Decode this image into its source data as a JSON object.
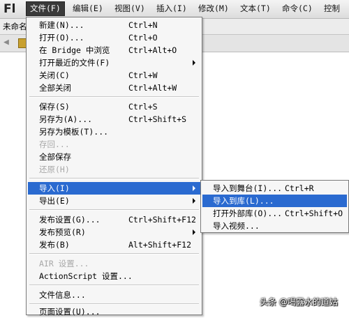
{
  "app": {
    "logo": "Fl"
  },
  "menubar": [
    "文件(F)",
    "编辑(E)",
    "视图(V)",
    "插入(I)",
    "修改(M)",
    "文本(T)",
    "命令(C)",
    "控制"
  ],
  "doc_tab": "未命名",
  "file_menu": {
    "items": [
      {
        "label": "新建(N)...",
        "shortcut": "Ctrl+N"
      },
      {
        "label": "打开(O)...",
        "shortcut": "Ctrl+O"
      },
      {
        "label": "在 Bridge 中浏览",
        "shortcut": "Ctrl+Alt+O"
      },
      {
        "label": "打开最近的文件(F)",
        "shortcut": ""
      },
      {
        "label": "关闭(C)",
        "shortcut": "Ctrl+W"
      },
      {
        "label": "全部关闭",
        "shortcut": "Ctrl+Alt+W"
      },
      {
        "label": "保存(S)",
        "shortcut": "Ctrl+S"
      },
      {
        "label": "另存为(A)...",
        "shortcut": "Ctrl+Shift+S"
      },
      {
        "label": "另存为模板(T)...",
        "shortcut": ""
      },
      {
        "label": "存回...",
        "shortcut": ""
      },
      {
        "label": "全部保存",
        "shortcut": ""
      },
      {
        "label": "还原(H)",
        "shortcut": ""
      },
      {
        "label": "导入(I)",
        "shortcut": ""
      },
      {
        "label": "导出(E)",
        "shortcut": ""
      },
      {
        "label": "发布设置(G)...",
        "shortcut": "Ctrl+Shift+F12"
      },
      {
        "label": "发布预览(R)",
        "shortcut": ""
      },
      {
        "label": "发布(B)",
        "shortcut": "Alt+Shift+F12"
      },
      {
        "label": "AIR 设置...",
        "shortcut": ""
      },
      {
        "label": "ActionScript 设置...",
        "shortcut": ""
      },
      {
        "label": "文件信息...",
        "shortcut": ""
      },
      {
        "label": "页面设置(U)...",
        "shortcut": ""
      }
    ]
  },
  "import_submenu": {
    "items": [
      {
        "label": "导入到舞台(I)...",
        "shortcut": "Ctrl+R"
      },
      {
        "label": "导入到库(L)...",
        "shortcut": ""
      },
      {
        "label": "打开外部库(O)...",
        "shortcut": "Ctrl+Shift+O"
      },
      {
        "label": "导入视频...",
        "shortcut": ""
      }
    ]
  },
  "watermark": "头条 @喝露水的道姑",
  "colors": {
    "highlight": "#2a6ad0",
    "disabled": "#a8a8a8",
    "menu_bg": "#f6f6f6"
  }
}
